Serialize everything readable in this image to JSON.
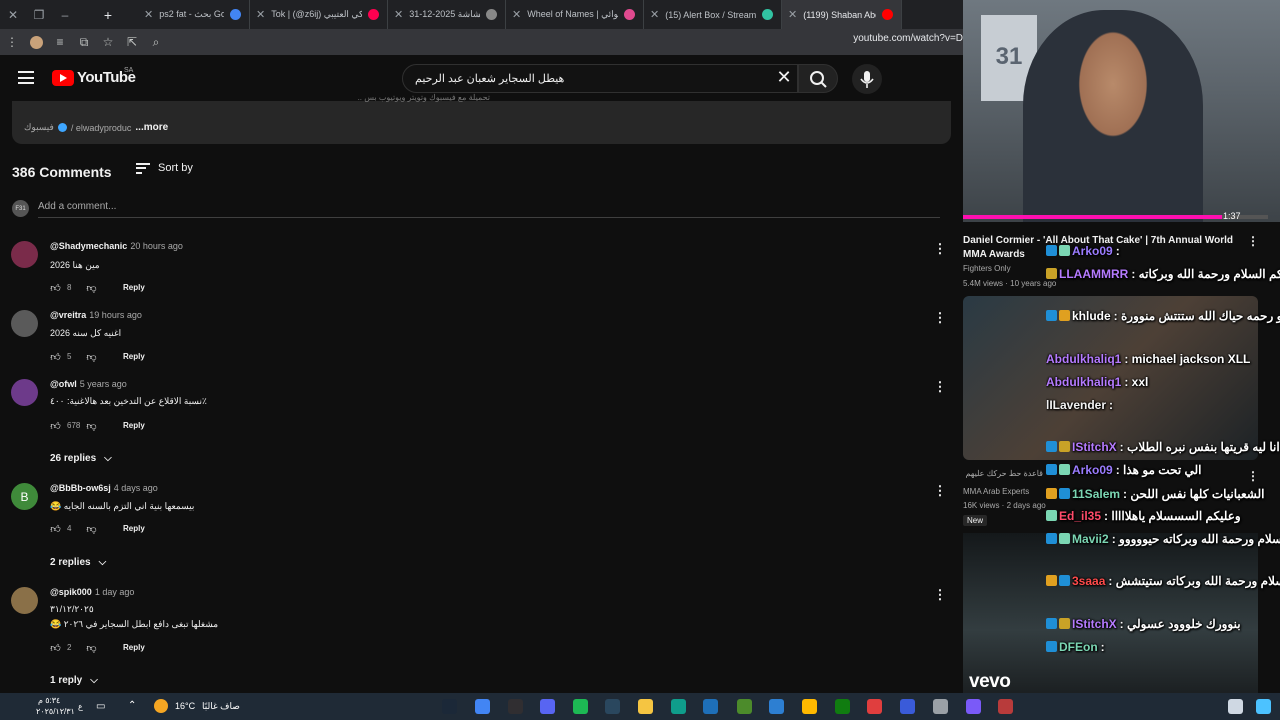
{
  "browser": {
    "tabs": [
      {
        "label": "ps2 fat - بحث Google",
        "favicon_color": "#4285f4",
        "active": false
      },
      {
        "label": "Tok | (@z6ij) تركي العتيبي",
        "favicon_color": "#ff0050",
        "active": false
      },
      {
        "label": "لقطة الشاشة 2025-12-31",
        "favicon_color": "#888888",
        "active": false
      },
      {
        "label": "Wheel of Names | عشوائي",
        "favicon_color": "#e04a8f",
        "active": false
      },
      {
        "label": "(15) Alert Box / Streamlab",
        "favicon_color": "#31c3a2",
        "active": false
      },
      {
        "label": "(1199) Shaban Abd El Re",
        "favicon_color": "#ff0000",
        "active": true
      }
    ],
    "new_tab_glyph": "+",
    "url": "youtube.com/watch?v=D"
  },
  "header": {
    "logo_text": "YouTube",
    "country": "SA",
    "search_value": "هيطل السجاير شعبان عبد الرحيم"
  },
  "description": {
    "top_line": "تحميلة مع فيسبوك وتويتر ويوتيوب بس ..",
    "link_label": "فيسبوك",
    "link_handle": "/ elwadyproduc",
    "more": "...more"
  },
  "comments_header": {
    "count": "386 Comments",
    "sort_label": "Sort by",
    "add_avatar": "F31",
    "add_placeholder": "Add a comment..."
  },
  "comments": [
    {
      "author": "@Shadymechanic",
      "time": "20 hours ago",
      "text": "مين هنا 2026",
      "text2": "",
      "likes": "8",
      "reply": "Reply",
      "avatar_color": "#7a2b4a",
      "avatar_letter": ""
    },
    {
      "author": "@vreitra",
      "time": "19 hours ago",
      "text": "اغنيه كل سنه 2026",
      "text2": "",
      "likes": "5",
      "reply": "Reply",
      "avatar_color": "#5a5a5a",
      "avatar_letter": ""
    },
    {
      "author": "@ofwl",
      "time": "5 years ago",
      "text": "نسبة الاقلاع عن التدخين بعد هالاغنية: ٤٠٠٪",
      "text2": "",
      "likes": "678",
      "reply": "Reply",
      "avatar_color": "#6d3a8a",
      "avatar_letter": "",
      "replies": "26 replies"
    },
    {
      "author": "@BbBb-ow6sj",
      "time": "4 days ago",
      "text": "😂 بيسمعها بنية اني التزم بالسنه الجايه",
      "text2": "",
      "likes": "4",
      "reply": "Reply",
      "avatar_color": "#3f8a3a",
      "avatar_letter": "B",
      "replies": "2 replies"
    },
    {
      "author": "@spik000",
      "time": "1 day ago",
      "text": "٣١/١٢/٢٠٢٥",
      "text2": "😂 مشغلها تبغى دافع ابطل السجاير في ٢٠٢٦",
      "likes": "2",
      "reply": "Reply",
      "avatar_color": "#8a7048",
      "avatar_letter": "",
      "replies": "1 reply"
    }
  ],
  "sidebar": {
    "webcam_jersey": "31",
    "video_duration": "1:37",
    "progress": 0.85,
    "rec1": {
      "title": "Daniel Cormier - 'All About That Cake' | 7th Annual World MMA Awards",
      "channel": "Fighters Only",
      "stats": "5.4M views · 10 years ago"
    },
    "rec2": {
      "title_fragment": "قاعدة حط حركك عليهم",
      "channel": "MMA Arab Experts",
      "stats": "16K views · 2 days ago",
      "badge": "New"
    },
    "rec3": {
      "label": "vevo"
    }
  },
  "chat": [
    {
      "user": "Arko09",
      "text": ":",
      "user_color": "#9b7cff",
      "badge_colors": [
        "#1f8fd6",
        "#7bd6b3"
      ]
    },
    {
      "user": "LLAAMMRR",
      "text": ": وعليكم السلام ورحمة الله وبركاته",
      "user_color": "#b57bff",
      "badge_colors": [
        "#c9a227"
      ]
    },
    {
      "user": "khlude",
      "text": ": و عليك السلام و رحمه حياك الله ستتتش منوورة",
      "user_color": "#ffffff",
      "badge_colors": [
        "#1f8fd6",
        "#e0a020"
      ]
    },
    {
      "user": "Abdulkhaliq1",
      "text": ": michael jackson XLL",
      "user_color": "#b57bff",
      "badge_colors": []
    },
    {
      "user": "Abdulkhaliq1",
      "text": ": xxl",
      "user_color": "#b57bff",
      "badge_colors": []
    },
    {
      "user": "lILavender",
      "text": ":",
      "user_color": "#f1f1f1",
      "badge_colors": []
    },
    {
      "user": "IStitchX",
      "text": ": انا ليه قريتها بنفس نبره الطلاب",
      "user_color": "#b57bff",
      "badge_colors": [
        "#1f8fd6",
        "#c9a227"
      ]
    },
    {
      "user": "Arko09",
      "text": ": الي تحت مو هذا",
      "user_color": "#9b7cff",
      "badge_colors": [
        "#1f8fd6",
        "#7bd6b3"
      ]
    },
    {
      "user": "11Salem",
      "text": ": الشعبانيات كلها نفس اللحن",
      "user_color": "#7bd6b3",
      "badge_colors": [
        "#e0a020",
        "#1f8fd6"
      ]
    },
    {
      "user": "Ed_il35",
      "text": ": وعليكم السسسلام ياهلااااا",
      "user_color": "#ff4b6a",
      "badge_colors": [
        "#7bd6b3"
      ]
    },
    {
      "user": "Mavii2",
      "text": ": وعليكم السلام ورحمة الله وبركاته حيووووو",
      "user_color": "#7bd6b3",
      "badge_colors": [
        "#1f8fd6",
        "#7bd6b3"
      ]
    },
    {
      "user": "3saaa",
      "text": ": وعليكم السلام ورحمة الله وبركاته ستيتشش",
      "user_color": "#ff4b4b",
      "badge_colors": [
        "#e0a020",
        "#1f8fd6"
      ]
    },
    {
      "user": "IStitchX",
      "text": ": بنوورك خلووود عسولي",
      "user_color": "#b57bff",
      "badge_colors": [
        "#1f8fd6",
        "#c9a227"
      ]
    },
    {
      "user": "DFEon",
      "text": ":",
      "user_color": "#7bd6b3",
      "badge_colors": [
        "#1f8fd6"
      ]
    }
  ],
  "taskbar": {
    "time": "٥:٣٤ م",
    "date": "٢٠٢٥/١٢/٣١",
    "temperature": "16°C",
    "weather": "صاف غالبًا",
    "lang": "ع"
  },
  "colors": {
    "youtube_red": "#ff0000",
    "progress_pink": "#ff0fb0",
    "background": "#0f0f0f"
  }
}
